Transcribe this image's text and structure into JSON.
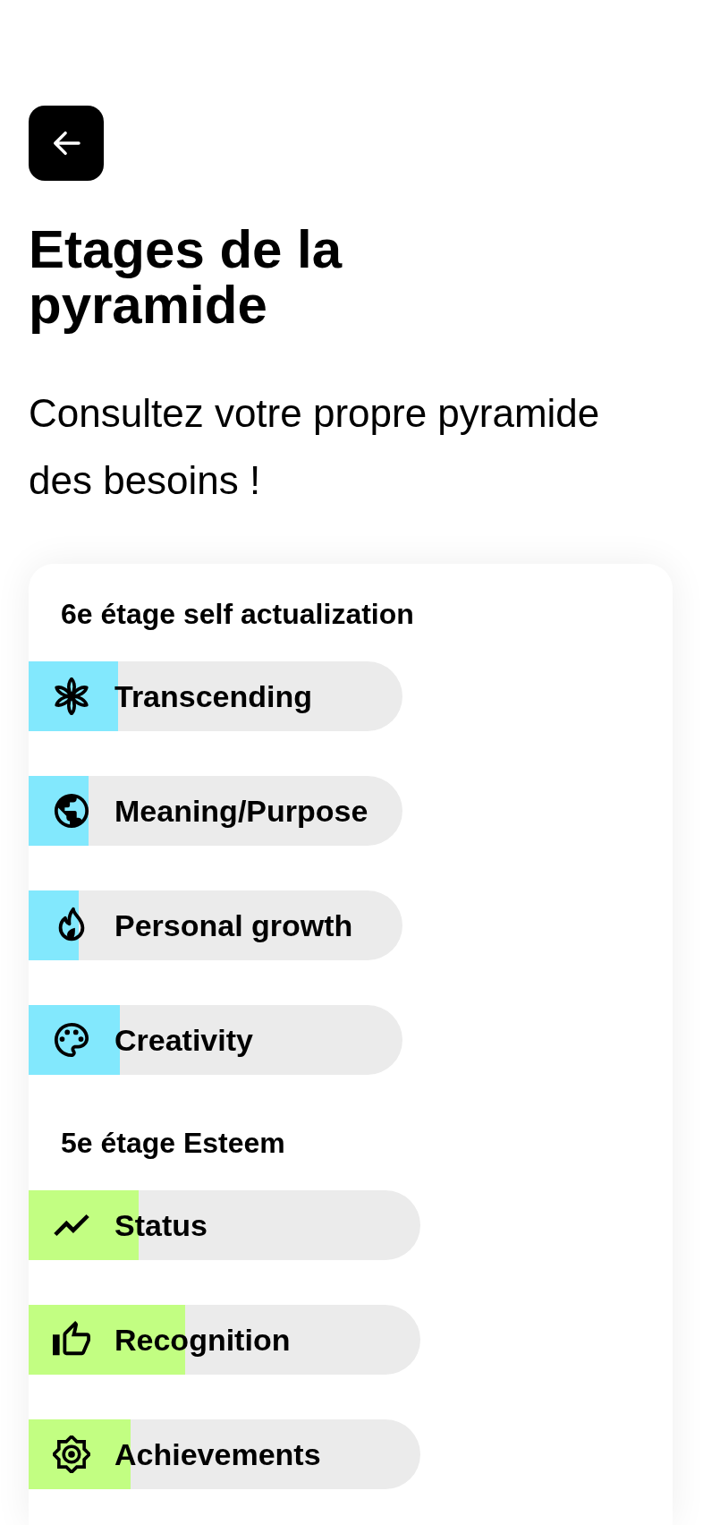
{
  "title": "Etages de la pyramide",
  "subtitle": "Consultez votre propre pyramide des besoins !",
  "sections": [
    {
      "title": "6e étage self actualization",
      "color": "#82e8fd",
      "items": [
        {
          "label": "Transcending",
          "level": 0.24
        },
        {
          "label": "Meaning/Purpose",
          "level": 0.16
        },
        {
          "label": "Personal growth",
          "level": 0.135
        },
        {
          "label": "Creativity",
          "level": 0.245
        }
      ]
    },
    {
      "title": "5e étage Esteem",
      "color": "#c2fe82",
      "items": [
        {
          "label": "Status",
          "level": 0.28
        },
        {
          "label": "Recognition",
          "level": 0.4
        },
        {
          "label": "Achievements",
          "level": 0.26
        }
      ]
    }
  ]
}
